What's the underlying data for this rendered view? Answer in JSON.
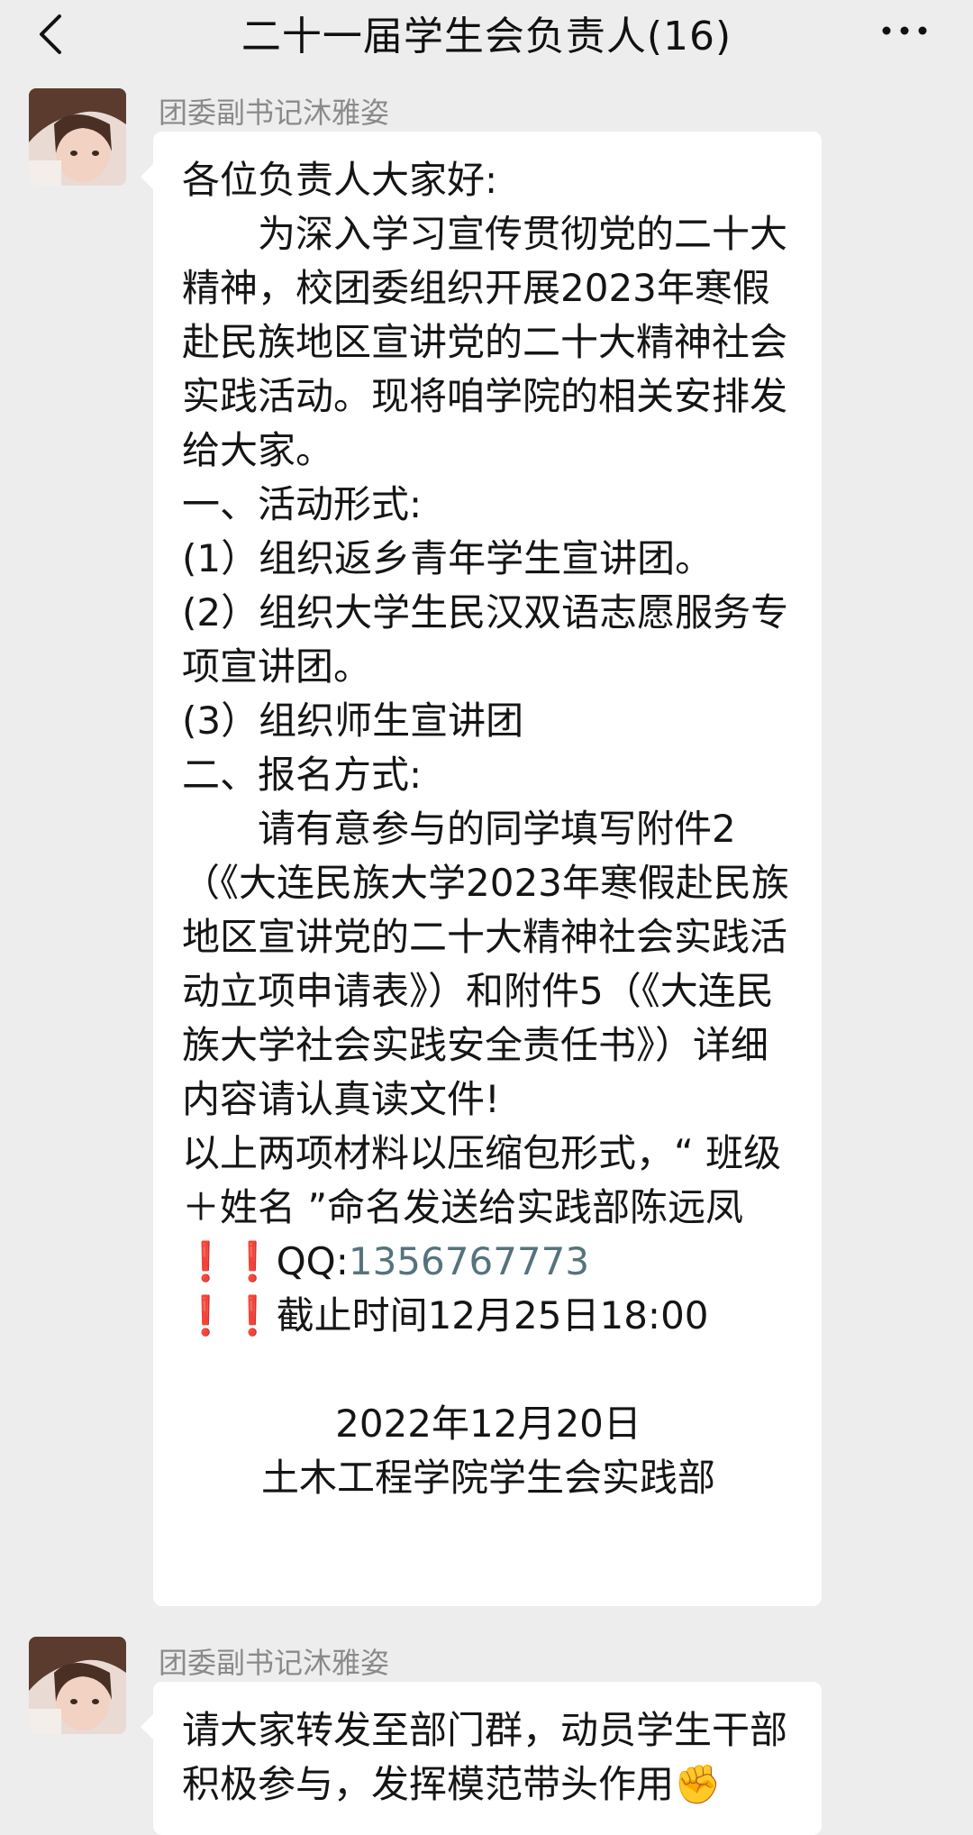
{
  "header": {
    "title": "二十一届学生会负责人(16)",
    "back_icon": "chevron-left-icon",
    "more_icon": "ellipsis-icon"
  },
  "messages": [
    {
      "sender": "团委副书记沐雅姿",
      "lines": {
        "greeting": "各位负责人大家好:",
        "intro": "为深入学习宣传贯彻党的二十大精神，校团委组织开展2023年寒假赴民族地区宣讲党的二十大精神社会实践活动。现将咱学院的相关安排发给大家。",
        "section1": "一、活动形式:",
        "item1": "(1）组织返乡青年学生宣讲团。",
        "item2": "(2）组织大学生民汉双语志愿服务专项宣讲团。",
        "item3": "(3）组织师生宣讲团",
        "section2": "二、报名方式:",
        "signup": "请有意参与的同学填写附件2（《大连民族大学2023年寒假赴民族地区宣讲党的二十大精神社会实践活动立项申请表》）和附件5（《大连民族大学社会实践安全责任书》）详细内容请认真读文件!",
        "submit": "以上两项材料以压缩包形式，“ 班级＋姓名 ”命名发送给实践部陈远凤",
        "qq_prefix": "❗❗QQ:",
        "qq_number": "1356767773",
        "deadline": "❗❗截止时间12月25日18:00",
        "date": "2022年12月20日",
        "signature": "土木工程学院学生会实践部"
      }
    },
    {
      "sender": "团委副书记沐雅姿",
      "lines": {
        "text": "请大家转发至部门群，动员学生干部积极参与，发挥模范带头作用✊"
      }
    }
  ],
  "colors": {
    "background": "#ededed",
    "bubble": "#ffffff",
    "sender": "#8a8a8a",
    "link": "#55737d"
  }
}
